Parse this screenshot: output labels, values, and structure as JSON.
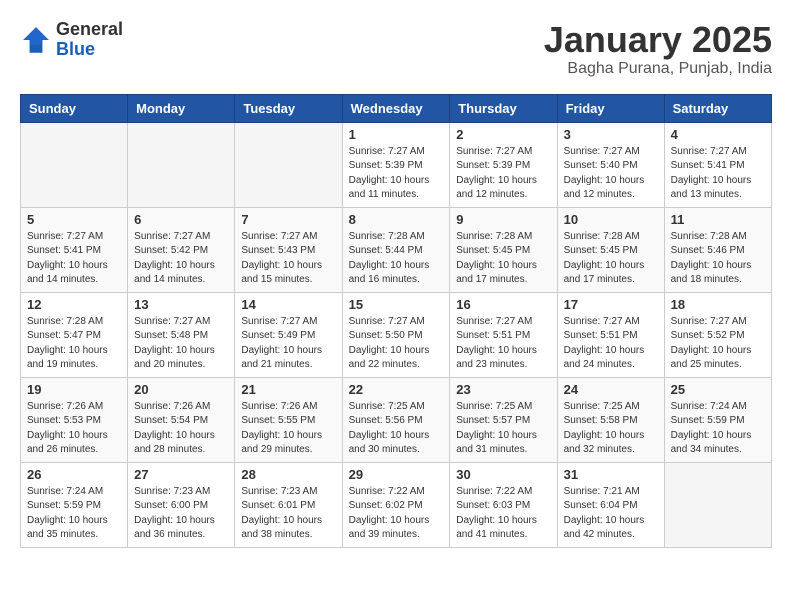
{
  "header": {
    "logo_general": "General",
    "logo_blue": "Blue",
    "month_title": "January 2025",
    "location": "Bagha Purana, Punjab, India"
  },
  "days_of_week": [
    "Sunday",
    "Monday",
    "Tuesday",
    "Wednesday",
    "Thursday",
    "Friday",
    "Saturday"
  ],
  "weeks": [
    [
      {
        "day": "",
        "info": ""
      },
      {
        "day": "",
        "info": ""
      },
      {
        "day": "",
        "info": ""
      },
      {
        "day": "1",
        "info": "Sunrise: 7:27 AM\nSunset: 5:39 PM\nDaylight: 10 hours\nand 11 minutes."
      },
      {
        "day": "2",
        "info": "Sunrise: 7:27 AM\nSunset: 5:39 PM\nDaylight: 10 hours\nand 12 minutes."
      },
      {
        "day": "3",
        "info": "Sunrise: 7:27 AM\nSunset: 5:40 PM\nDaylight: 10 hours\nand 12 minutes."
      },
      {
        "day": "4",
        "info": "Sunrise: 7:27 AM\nSunset: 5:41 PM\nDaylight: 10 hours\nand 13 minutes."
      }
    ],
    [
      {
        "day": "5",
        "info": "Sunrise: 7:27 AM\nSunset: 5:41 PM\nDaylight: 10 hours\nand 14 minutes."
      },
      {
        "day": "6",
        "info": "Sunrise: 7:27 AM\nSunset: 5:42 PM\nDaylight: 10 hours\nand 14 minutes."
      },
      {
        "day": "7",
        "info": "Sunrise: 7:27 AM\nSunset: 5:43 PM\nDaylight: 10 hours\nand 15 minutes."
      },
      {
        "day": "8",
        "info": "Sunrise: 7:28 AM\nSunset: 5:44 PM\nDaylight: 10 hours\nand 16 minutes."
      },
      {
        "day": "9",
        "info": "Sunrise: 7:28 AM\nSunset: 5:45 PM\nDaylight: 10 hours\nand 17 minutes."
      },
      {
        "day": "10",
        "info": "Sunrise: 7:28 AM\nSunset: 5:45 PM\nDaylight: 10 hours\nand 17 minutes."
      },
      {
        "day": "11",
        "info": "Sunrise: 7:28 AM\nSunset: 5:46 PM\nDaylight: 10 hours\nand 18 minutes."
      }
    ],
    [
      {
        "day": "12",
        "info": "Sunrise: 7:28 AM\nSunset: 5:47 PM\nDaylight: 10 hours\nand 19 minutes."
      },
      {
        "day": "13",
        "info": "Sunrise: 7:27 AM\nSunset: 5:48 PM\nDaylight: 10 hours\nand 20 minutes."
      },
      {
        "day": "14",
        "info": "Sunrise: 7:27 AM\nSunset: 5:49 PM\nDaylight: 10 hours\nand 21 minutes."
      },
      {
        "day": "15",
        "info": "Sunrise: 7:27 AM\nSunset: 5:50 PM\nDaylight: 10 hours\nand 22 minutes."
      },
      {
        "day": "16",
        "info": "Sunrise: 7:27 AM\nSunset: 5:51 PM\nDaylight: 10 hours\nand 23 minutes."
      },
      {
        "day": "17",
        "info": "Sunrise: 7:27 AM\nSunset: 5:51 PM\nDaylight: 10 hours\nand 24 minutes."
      },
      {
        "day": "18",
        "info": "Sunrise: 7:27 AM\nSunset: 5:52 PM\nDaylight: 10 hours\nand 25 minutes."
      }
    ],
    [
      {
        "day": "19",
        "info": "Sunrise: 7:26 AM\nSunset: 5:53 PM\nDaylight: 10 hours\nand 26 minutes."
      },
      {
        "day": "20",
        "info": "Sunrise: 7:26 AM\nSunset: 5:54 PM\nDaylight: 10 hours\nand 28 minutes."
      },
      {
        "day": "21",
        "info": "Sunrise: 7:26 AM\nSunset: 5:55 PM\nDaylight: 10 hours\nand 29 minutes."
      },
      {
        "day": "22",
        "info": "Sunrise: 7:25 AM\nSunset: 5:56 PM\nDaylight: 10 hours\nand 30 minutes."
      },
      {
        "day": "23",
        "info": "Sunrise: 7:25 AM\nSunset: 5:57 PM\nDaylight: 10 hours\nand 31 minutes."
      },
      {
        "day": "24",
        "info": "Sunrise: 7:25 AM\nSunset: 5:58 PM\nDaylight: 10 hours\nand 32 minutes."
      },
      {
        "day": "25",
        "info": "Sunrise: 7:24 AM\nSunset: 5:59 PM\nDaylight: 10 hours\nand 34 minutes."
      }
    ],
    [
      {
        "day": "26",
        "info": "Sunrise: 7:24 AM\nSunset: 5:59 PM\nDaylight: 10 hours\nand 35 minutes."
      },
      {
        "day": "27",
        "info": "Sunrise: 7:23 AM\nSunset: 6:00 PM\nDaylight: 10 hours\nand 36 minutes."
      },
      {
        "day": "28",
        "info": "Sunrise: 7:23 AM\nSunset: 6:01 PM\nDaylight: 10 hours\nand 38 minutes."
      },
      {
        "day": "29",
        "info": "Sunrise: 7:22 AM\nSunset: 6:02 PM\nDaylight: 10 hours\nand 39 minutes."
      },
      {
        "day": "30",
        "info": "Sunrise: 7:22 AM\nSunset: 6:03 PM\nDaylight: 10 hours\nand 41 minutes."
      },
      {
        "day": "31",
        "info": "Sunrise: 7:21 AM\nSunset: 6:04 PM\nDaylight: 10 hours\nand 42 minutes."
      },
      {
        "day": "",
        "info": ""
      }
    ]
  ]
}
